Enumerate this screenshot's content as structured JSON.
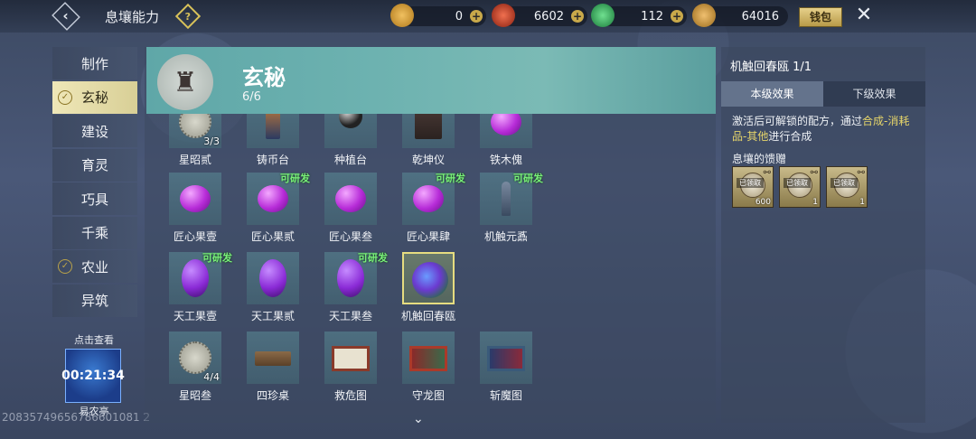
{
  "header": {
    "title": "息壤能力",
    "back_icon": "back-chevron-icon",
    "help_icon": "help-icon",
    "bag_label": "钱包",
    "close_icon": "close-icon"
  },
  "currencies": [
    {
      "name": "gold-coin-icon",
      "value": "0",
      "color": "#d9a23a"
    },
    {
      "name": "red-orb-icon",
      "value": "6602",
      "color": "#c8452e"
    },
    {
      "name": "jade-icon",
      "value": "112",
      "color": "#3ab45a"
    },
    {
      "name": "feather-icon",
      "value": "64016",
      "color": "#c89a3a"
    }
  ],
  "nav": {
    "items": [
      {
        "label": "制作",
        "active": false,
        "check": false
      },
      {
        "label": "玄秘",
        "active": true,
        "check": true
      },
      {
        "label": "建设",
        "active": false,
        "check": false
      },
      {
        "label": "育灵",
        "active": false,
        "check": false
      },
      {
        "label": "巧具",
        "active": false,
        "check": false
      },
      {
        "label": "千乘",
        "active": false,
        "check": false
      },
      {
        "label": "农业",
        "active": false,
        "check": true
      },
      {
        "label": "异筑",
        "active": false,
        "check": false
      }
    ]
  },
  "timer": {
    "caption": "点击查看",
    "time": "00:21:34",
    "label": "易农亭"
  },
  "uid": "20835749656786601081 2",
  "category": {
    "title": "玄秘",
    "count": "6/6"
  },
  "items": [
    {
      "label": "星昭贰",
      "qty": "3/3",
      "badge": "",
      "icon": "disc"
    },
    {
      "label": "铸币台",
      "qty": "",
      "badge": "",
      "icon": "tower"
    },
    {
      "label": "种植台",
      "qty": "",
      "badge": "",
      "icon": "sphere"
    },
    {
      "label": "乾坤仪",
      "qty": "",
      "badge": "",
      "icon": "obj"
    },
    {
      "label": "铁木傀",
      "qty": "",
      "badge": "",
      "icon": "gem-round"
    },
    {
      "label": "匠心果壹",
      "qty": "",
      "badge": "",
      "icon": "gem-round"
    },
    {
      "label": "匠心果贰",
      "qty": "",
      "badge": "可研发",
      "icon": "gem-round"
    },
    {
      "label": "匠心果叁",
      "qty": "",
      "badge": "",
      "icon": "gem-round"
    },
    {
      "label": "匠心果肆",
      "qty": "",
      "badge": "可研发",
      "icon": "gem-round"
    },
    {
      "label": "机触元鼒",
      "qty": "",
      "badge": "可研发",
      "icon": "puppet"
    },
    {
      "label": "天工果壹",
      "qty": "",
      "badge": "可研发",
      "icon": "gem-oval"
    },
    {
      "label": "天工果贰",
      "qty": "",
      "badge": "",
      "icon": "gem-oval"
    },
    {
      "label": "天工果叁",
      "qty": "",
      "badge": "可研发",
      "icon": "gem-oval"
    },
    {
      "label": "机触回春瓯",
      "qty": "",
      "badge": "",
      "icon": "opal",
      "selected": true
    },
    {
      "label": "星昭叁",
      "qty": "4/4",
      "badge": "",
      "icon": "disc"
    },
    {
      "label": "四珍桌",
      "qty": "",
      "badge": "",
      "icon": "table"
    },
    {
      "label": "救危图",
      "qty": "",
      "badge": "",
      "icon": "scroll"
    },
    {
      "label": "守龙图",
      "qty": "",
      "badge": "",
      "icon": "scroll-red"
    },
    {
      "label": "斩魔图",
      "qty": "",
      "badge": "",
      "icon": "scroll-blue"
    }
  ],
  "detail": {
    "title": "机触回春瓯 1/1",
    "tabs": [
      "本级效果",
      "下级效果"
    ],
    "desc_prefix": "激活后可解锁的配方，通过",
    "desc_hl1": "合成-消耗品-其他",
    "desc_suffix": "进行合成",
    "gift_title": "息壤的馈赠",
    "gifts": [
      {
        "stamp": "已领取",
        "qty": "600"
      },
      {
        "stamp": "已领取",
        "qty": "1"
      },
      {
        "stamp": "已领取",
        "qty": "1"
      }
    ]
  },
  "scroll_icon": "chevron-down-icon"
}
